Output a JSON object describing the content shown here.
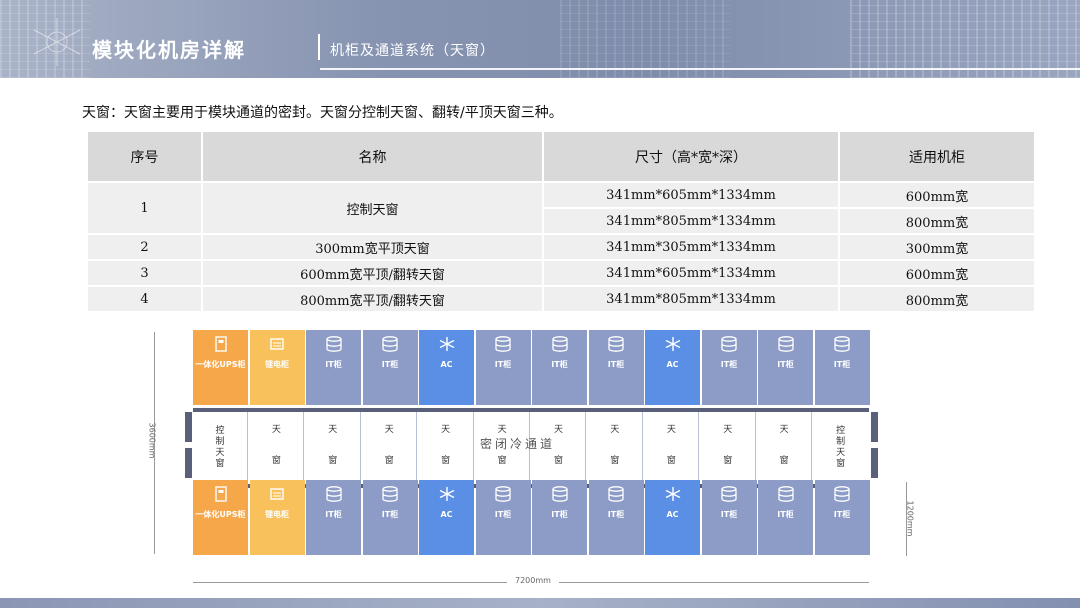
{
  "header": {
    "title": "模块化机房详解",
    "subtitle": "机柜及通道系统（天窗）"
  },
  "intro": "天窗：天窗主要用于模块通道的密封。天窗分控制天窗、翻转/平顶天窗三种。",
  "table": {
    "headers": [
      "序号",
      "名称",
      "尺寸（高*宽*深）",
      "适用机柜"
    ],
    "rows": [
      {
        "no": "1",
        "name": "控制天窗",
        "sizes": [
          "341mm*605mm*1334mm",
          "341mm*805mm*1334mm"
        ],
        "cabinets": [
          "600mm宽",
          "800mm宽"
        ]
      },
      {
        "no": "2",
        "name": "300mm宽平顶天窗",
        "size": "341mm*305mm*1334mm",
        "cabinet": "300mm宽"
      },
      {
        "no": "3",
        "name": "600mm宽平顶/翻转天窗",
        "size": "341mm*605mm*1334mm",
        "cabinet": "600mm宽"
      },
      {
        "no": "4",
        "name": "800mm宽平顶/翻转天窗",
        "size": "341mm*805mm*1334mm",
        "cabinet": "800mm宽"
      }
    ]
  },
  "diagram": {
    "top_cabinets": [
      "一体化UPS柜",
      "锂电柜",
      "IT柜",
      "IT柜",
      "AC",
      "IT柜",
      "IT柜",
      "IT柜",
      "AC",
      "IT柜",
      "IT柜",
      "IT柜"
    ],
    "bottom_cabinets": [
      "一体化UPS柜",
      "锂电柜",
      "IT柜",
      "IT柜",
      "AC",
      "IT柜",
      "IT柜",
      "IT柜",
      "AC",
      "IT柜",
      "IT柜",
      "IT柜"
    ],
    "cabinet_types": [
      "ups",
      "batt",
      "it",
      "it",
      "ac",
      "it",
      "it",
      "it",
      "ac",
      "it",
      "it",
      "it"
    ],
    "skylight_control_label": "控制天窗",
    "skylight_label_top": "天",
    "skylight_label_bottom": "窗",
    "aisle_label": "密闭冷通道",
    "dim_height": "3600mm",
    "dim_width": "7200mm",
    "dim_depth": "1200mm",
    "colors": {
      "ups": "#f5a74a",
      "batt": "#f8c15b",
      "it": "#8d9cc7",
      "ac": "#5b8fe6",
      "frame": "#5a6079"
    }
  }
}
